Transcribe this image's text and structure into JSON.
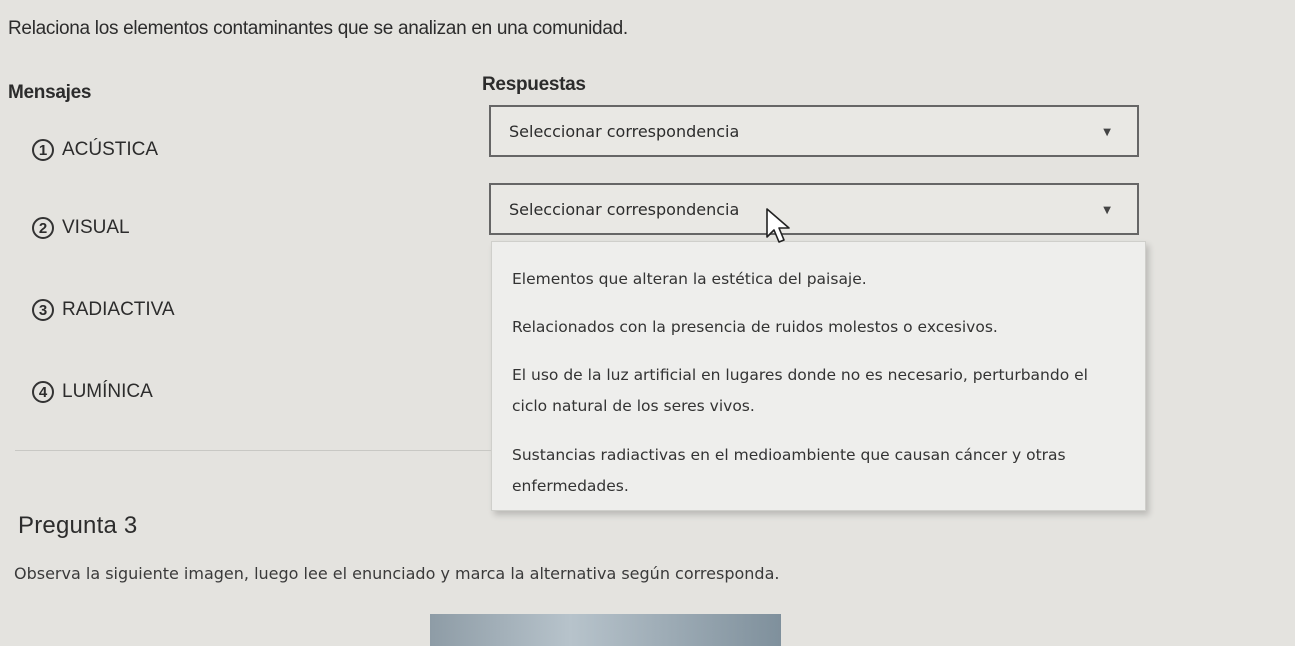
{
  "instruction": "Relaciona los elementos contaminantes que se analizan en una comunidad.",
  "columns": {
    "messages": "Mensajes",
    "answers": "Respuestas"
  },
  "messages": [
    {
      "number": "1",
      "label": "ACÚSTICA"
    },
    {
      "number": "2",
      "label": "VISUAL"
    },
    {
      "number": "3",
      "label": "RADIACTIVA"
    },
    {
      "number": "4",
      "label": "LUMÍNICA"
    }
  ],
  "selects": [
    {
      "value": "Seleccionar correspondencia"
    },
    {
      "value": "Seleccionar correspondencia"
    }
  ],
  "dropdown_options": [
    {
      "line1": "Elementos que alteran la estética del paisaje.",
      "line2": ""
    },
    {
      "line1": "Relacionados con la presencia de ruidos molestos o excesivos.",
      "line2": ""
    },
    {
      "line1": "El uso de la luz artificial en lugares donde no es necesario, perturbando el",
      "line2": "ciclo natural de los seres vivos."
    },
    {
      "line1": "Sustancias radiactivas en el medioambiente que causan cáncer y otras",
      "line2": "enfermedades."
    }
  ],
  "next_question": {
    "title": "Pregunta 3",
    "prompt": "Observa la siguiente imagen, luego lee el enunciado y marca la alternativa según corresponda."
  },
  "icons": {
    "dropdown_arrow": "caret-down-icon",
    "cursor": "mouse-pointer-icon"
  }
}
